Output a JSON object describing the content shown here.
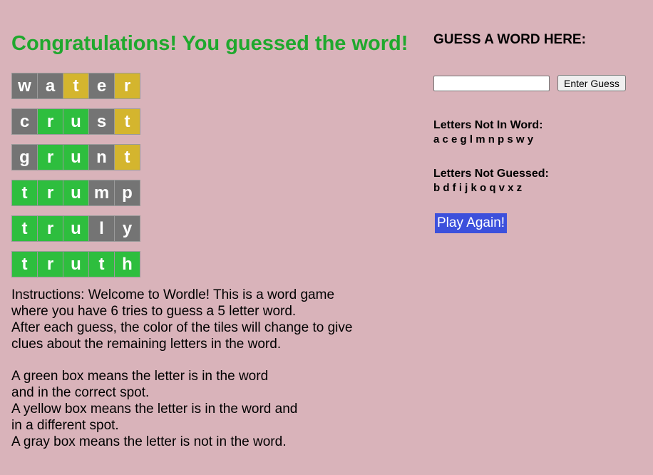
{
  "header": {
    "congrats": "Congratulations! You guessed the word!"
  },
  "board": {
    "rows": [
      [
        {
          "letter": "w",
          "state": "gray"
        },
        {
          "letter": "a",
          "state": "gray"
        },
        {
          "letter": "t",
          "state": "yellow"
        },
        {
          "letter": "e",
          "state": "gray"
        },
        {
          "letter": "r",
          "state": "yellow"
        }
      ],
      [
        {
          "letter": "c",
          "state": "gray"
        },
        {
          "letter": "r",
          "state": "green"
        },
        {
          "letter": "u",
          "state": "green"
        },
        {
          "letter": "s",
          "state": "gray"
        },
        {
          "letter": "t",
          "state": "yellow"
        }
      ],
      [
        {
          "letter": "g",
          "state": "gray"
        },
        {
          "letter": "r",
          "state": "green"
        },
        {
          "letter": "u",
          "state": "green"
        },
        {
          "letter": "n",
          "state": "gray"
        },
        {
          "letter": "t",
          "state": "yellow"
        }
      ],
      [
        {
          "letter": "t",
          "state": "green"
        },
        {
          "letter": "r",
          "state": "green"
        },
        {
          "letter": "u",
          "state": "green"
        },
        {
          "letter": "m",
          "state": "gray"
        },
        {
          "letter": "p",
          "state": "gray"
        }
      ],
      [
        {
          "letter": "t",
          "state": "green"
        },
        {
          "letter": "r",
          "state": "green"
        },
        {
          "letter": "u",
          "state": "green"
        },
        {
          "letter": "l",
          "state": "gray"
        },
        {
          "letter": "y",
          "state": "gray"
        }
      ],
      [
        {
          "letter": "t",
          "state": "green"
        },
        {
          "letter": "r",
          "state": "green"
        },
        {
          "letter": "u",
          "state": "green"
        },
        {
          "letter": "t",
          "state": "green"
        },
        {
          "letter": "h",
          "state": "green"
        }
      ]
    ]
  },
  "instructions": {
    "p1": [
      "Instructions: Welcome to Wordle! This is a word game",
      "where you have 6 tries to guess a 5 letter word.",
      "After each guess, the color of the tiles will change to give",
      "clues about the remaining letters in the word."
    ],
    "p2": [
      "A green box means the letter is in the word",
      "and in the correct spot.",
      "A yellow box means the letter is in the word and",
      "in a different spot.",
      "A gray box means the letter is not in the word."
    ]
  },
  "sidebar": {
    "guess_title": "GUESS A WORD HERE:",
    "guess_input_value": "",
    "enter_guess_label": "Enter Guess",
    "not_in_word_label": "Letters Not In Word:",
    "not_in_word_letters": "a c e g l m n p s w y",
    "not_guessed_label": "Letters Not Guessed:",
    "not_guessed_letters": "b d f i j k o q v x z",
    "play_again_label": "Play Again!"
  },
  "colors": {
    "background": "#d9b3ba",
    "congrats_text": "#1fa82d",
    "tile_green": "#2ebe3e",
    "tile_yellow": "#d4b52e",
    "tile_gray": "#747474",
    "play_again_bg": "#3c50dc"
  }
}
